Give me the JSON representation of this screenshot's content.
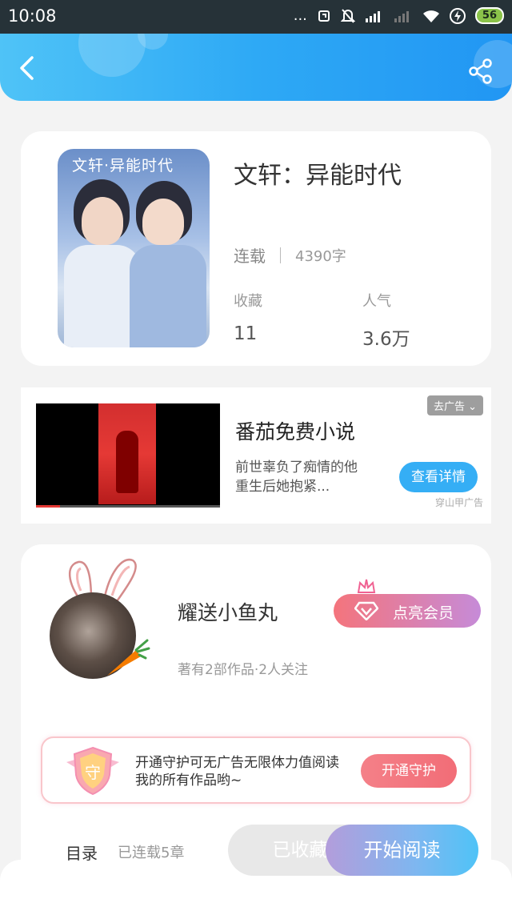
{
  "status_bar": {
    "time": "10:08",
    "dots": "...",
    "battery": "56"
  },
  "header": {
    "back_icon": "chevron-left-icon",
    "share_icon": "share-icon"
  },
  "book": {
    "cover_title": "文轩·异能时代",
    "title": "文轩：异能时代",
    "status": "连载",
    "word_count": "4390字",
    "favorites_label": "收藏",
    "favorites_value": "11",
    "popularity_label": "人气",
    "popularity_value": "3.6万"
  },
  "ad": {
    "tag": "去广告 ⌄",
    "title": "番茄免费小说",
    "description": "前世辜负了痴情的他  重生后她抱紧...",
    "button": "查看详情",
    "source": "穿山甲广告"
  },
  "author": {
    "name": "耀送小鱼丸",
    "meta": "著有2部作品·2人关注",
    "vip_button": "点亮会员",
    "guard_badge": "守",
    "guard_text": "开通守护可无广告无限体力值阅读我的所有作品哟~",
    "guard_button": "开通守护"
  },
  "bottom_bar": {
    "toc_label": "目录",
    "chapter_status": "已连载5章",
    "collected_label": "已收藏",
    "read_button": "开始阅读"
  },
  "colors": {
    "header_start": "#4fc3f7",
    "header_end": "#2196f3",
    "accent_blue": "#35aef5",
    "vip_pink": "#f4747c",
    "vip_purple": "#c68bd8"
  }
}
